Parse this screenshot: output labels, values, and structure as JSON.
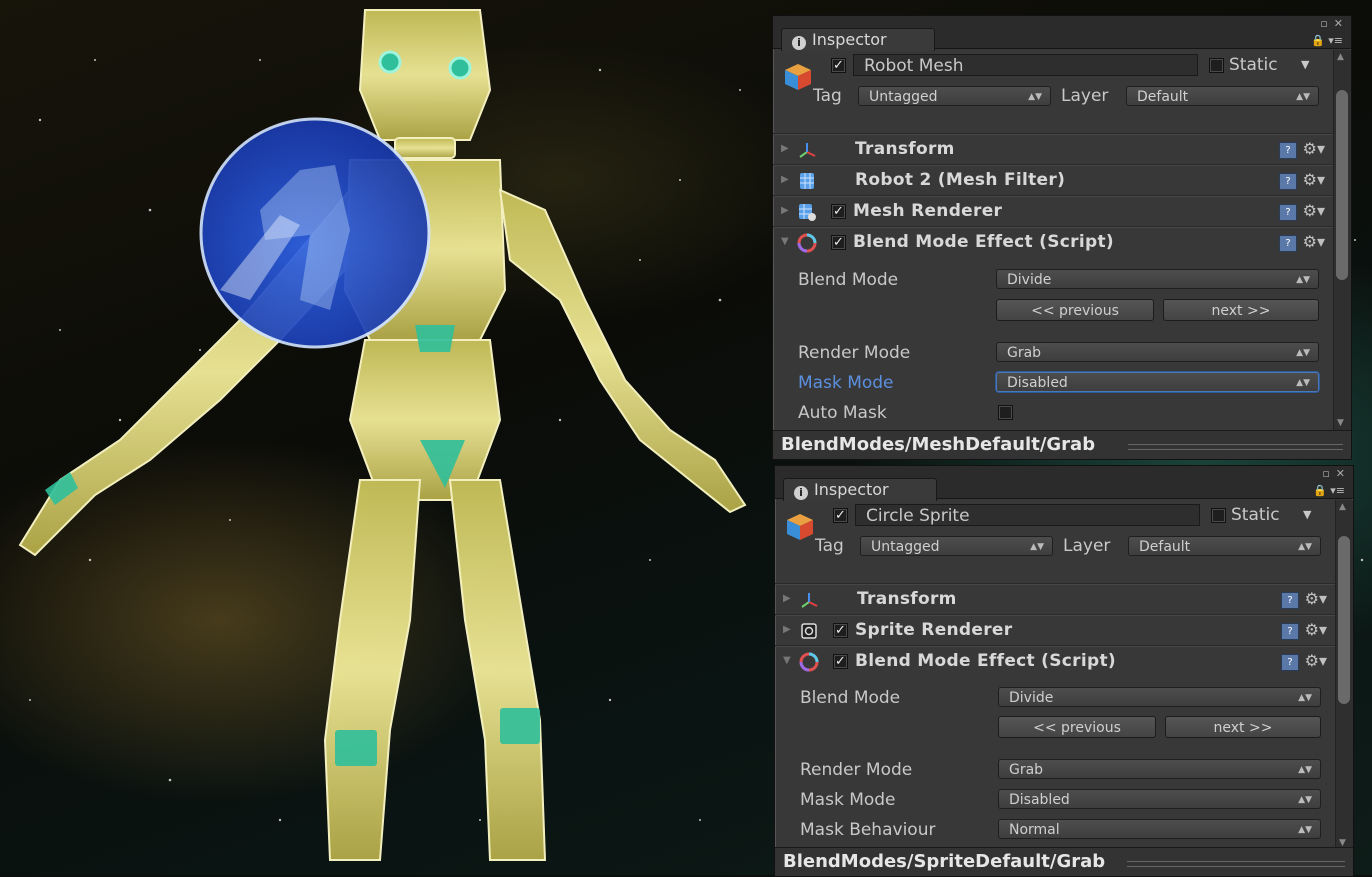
{
  "panels": [
    {
      "tab_label": "Inspector",
      "object_name": "Robot Mesh",
      "static_label": "Static",
      "tag_label": "Tag",
      "tag_value": "Untagged",
      "layer_label": "Layer",
      "layer_value": "Default",
      "components": [
        {
          "title": "Transform",
          "has_checkbox": false,
          "icon": "transform-icon"
        },
        {
          "title": "Robot 2 (Mesh Filter)",
          "has_checkbox": false,
          "icon": "mesh-filter-icon"
        },
        {
          "title": "Mesh Renderer",
          "has_checkbox": true,
          "icon": "mesh-renderer-icon"
        },
        {
          "title": "Blend Mode Effect (Script)",
          "has_checkbox": true,
          "icon": "script-icon"
        }
      ],
      "blend_mode_label": "Blend Mode",
      "blend_mode_value": "Divide",
      "previous_label": "<< previous",
      "next_label": "next >>",
      "render_mode_label": "Render Mode",
      "render_mode_value": "Grab",
      "mask_mode_label": "Mask Mode",
      "mask_mode_value": "Disabled",
      "auto_mask_label": "Auto Mask",
      "footer_title": "BlendModes/MeshDefault/Grab"
    },
    {
      "tab_label": "Inspector",
      "object_name": "Circle Sprite",
      "static_label": "Static",
      "tag_label": "Tag",
      "tag_value": "Untagged",
      "layer_label": "Layer",
      "layer_value": "Default",
      "components": [
        {
          "title": "Transform",
          "has_checkbox": false,
          "icon": "transform-icon"
        },
        {
          "title": "Sprite Renderer",
          "has_checkbox": true,
          "icon": "sprite-renderer-icon"
        },
        {
          "title": "Blend Mode Effect (Script)",
          "has_checkbox": true,
          "icon": "script-icon"
        }
      ],
      "blend_mode_label": "Blend Mode",
      "blend_mode_value": "Divide",
      "previous_label": "<< previous",
      "next_label": "next >>",
      "render_mode_label": "Render Mode",
      "render_mode_value": "Grab",
      "mask_mode_label": "Mask Mode",
      "mask_mode_value": "Disabled",
      "mask_behaviour_label": "Mask Behaviour",
      "mask_behaviour_value": "Normal",
      "footer_title": "BlendModes/SpriteDefault/Grab"
    }
  ],
  "colors": {
    "panel_bg": "#383838",
    "focused_label": "#5b8fe0",
    "robot_glow": "#e8e070",
    "robot_accent": "#2fbf9a",
    "sprite_circle": "#1f4fd0"
  }
}
